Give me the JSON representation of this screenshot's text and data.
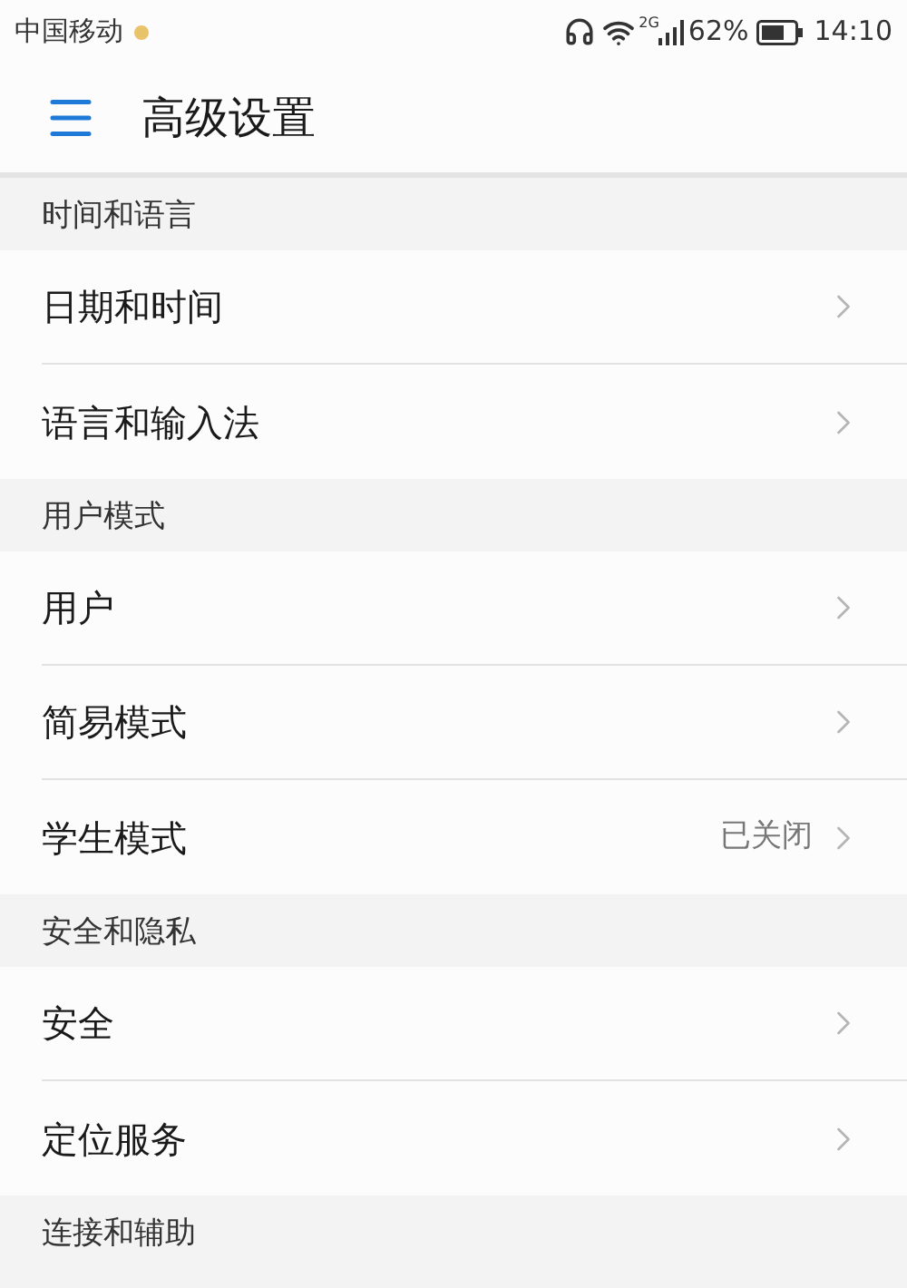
{
  "status_bar": {
    "carrier": "中国移动",
    "network": "2G",
    "battery": "62%",
    "time": "14:10"
  },
  "header": {
    "title": "高级设置"
  },
  "sections": [
    {
      "title": "时间和语言",
      "items": [
        {
          "label": "日期和时间"
        },
        {
          "label": "语言和输入法"
        }
      ]
    },
    {
      "title": "用户模式",
      "items": [
        {
          "label": "用户"
        },
        {
          "label": "简易模式"
        },
        {
          "label": "学生模式",
          "value": "已关闭"
        }
      ]
    },
    {
      "title": "安全和隐私",
      "items": [
        {
          "label": "安全"
        },
        {
          "label": "定位服务"
        }
      ]
    },
    {
      "title": "连接和辅助"
    }
  ]
}
